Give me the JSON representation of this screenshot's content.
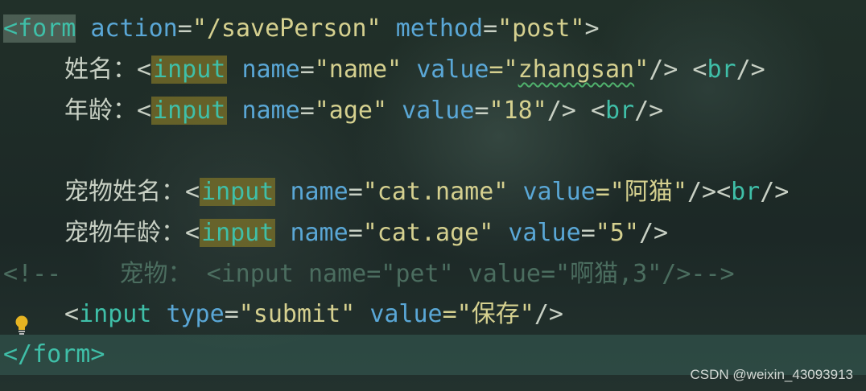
{
  "code": {
    "line1": {
      "open": "<",
      "tag": "form",
      "attr1": "action",
      "eq1": "=",
      "val1": "\"/savePerson\"",
      "attr2": "method",
      "eq2": "=",
      "val2": "\"post\"",
      "close": ">"
    },
    "line2": {
      "label": "姓名：",
      "open": "<",
      "tag": "input",
      "attr1": "name",
      "eq1": "=",
      "val1": "\"name\"",
      "attr2": "value",
      "eq2": "=\"",
      "val2_word": "zhangsan",
      "val2_end": "\"",
      "selfclose": "/>",
      "br_open": "<",
      "br": "br",
      "br_close": "/>"
    },
    "line3": {
      "label": "年龄：",
      "open": "<",
      "tag": "input",
      "attr1": "name",
      "eq1": "=",
      "val1": "\"age\"",
      "attr2": "value",
      "eq2": "=",
      "val2": "\"18\"",
      "selfclose": "/>",
      "br_open": "<",
      "br": "br",
      "br_close": "/>"
    },
    "line5": {
      "label": "宠物姓名：",
      "open": "<",
      "tag": "input",
      "attr1": "name",
      "eq1": "=",
      "val1": "\"cat.name\"",
      "attr2": "value",
      "eq2": "=\"",
      "val2_cn": "阿猫",
      "val2_end": "\"",
      "selfclose": "/>",
      "br_open": "<",
      "br": "br",
      "br_close": "/>"
    },
    "line6": {
      "label": "宠物年龄：",
      "open": "<",
      "tag": "input",
      "attr1": "name",
      "eq1": "=",
      "val1": "\"cat.age\"",
      "attr2": "value",
      "eq2": "=",
      "val2": "\"5\"",
      "selfclose": "/>"
    },
    "line7": {
      "comment_open": "<!--",
      "comment_label": "宠物：",
      "comment_code": "<input name=\"pet\" value=\"",
      "comment_cn": "啊猫",
      "comment_tail": ",3\"/>-->"
    },
    "line8": {
      "open": "<",
      "tag": "input",
      "attr1": "type",
      "eq1": "=",
      "val1": "\"submit\"",
      "attr2": "value",
      "eq2": "=\"",
      "val2_cn": "保存",
      "val2_end": "\"",
      "selfclose": "/>"
    },
    "line9": {
      "open": "</",
      "tag": "form",
      "close": ">"
    }
  },
  "gutter": {
    "intention_icon": "lightbulb-icon",
    "color": "#e6b422"
  },
  "watermark": {
    "text": "CSDN @weixin_43093913"
  },
  "colors": {
    "tag": "#3fbfa8",
    "attribute": "#5aa7d6",
    "string": "#d5d08f",
    "comment": "#4b6d5f",
    "highlight": "#807428"
  }
}
